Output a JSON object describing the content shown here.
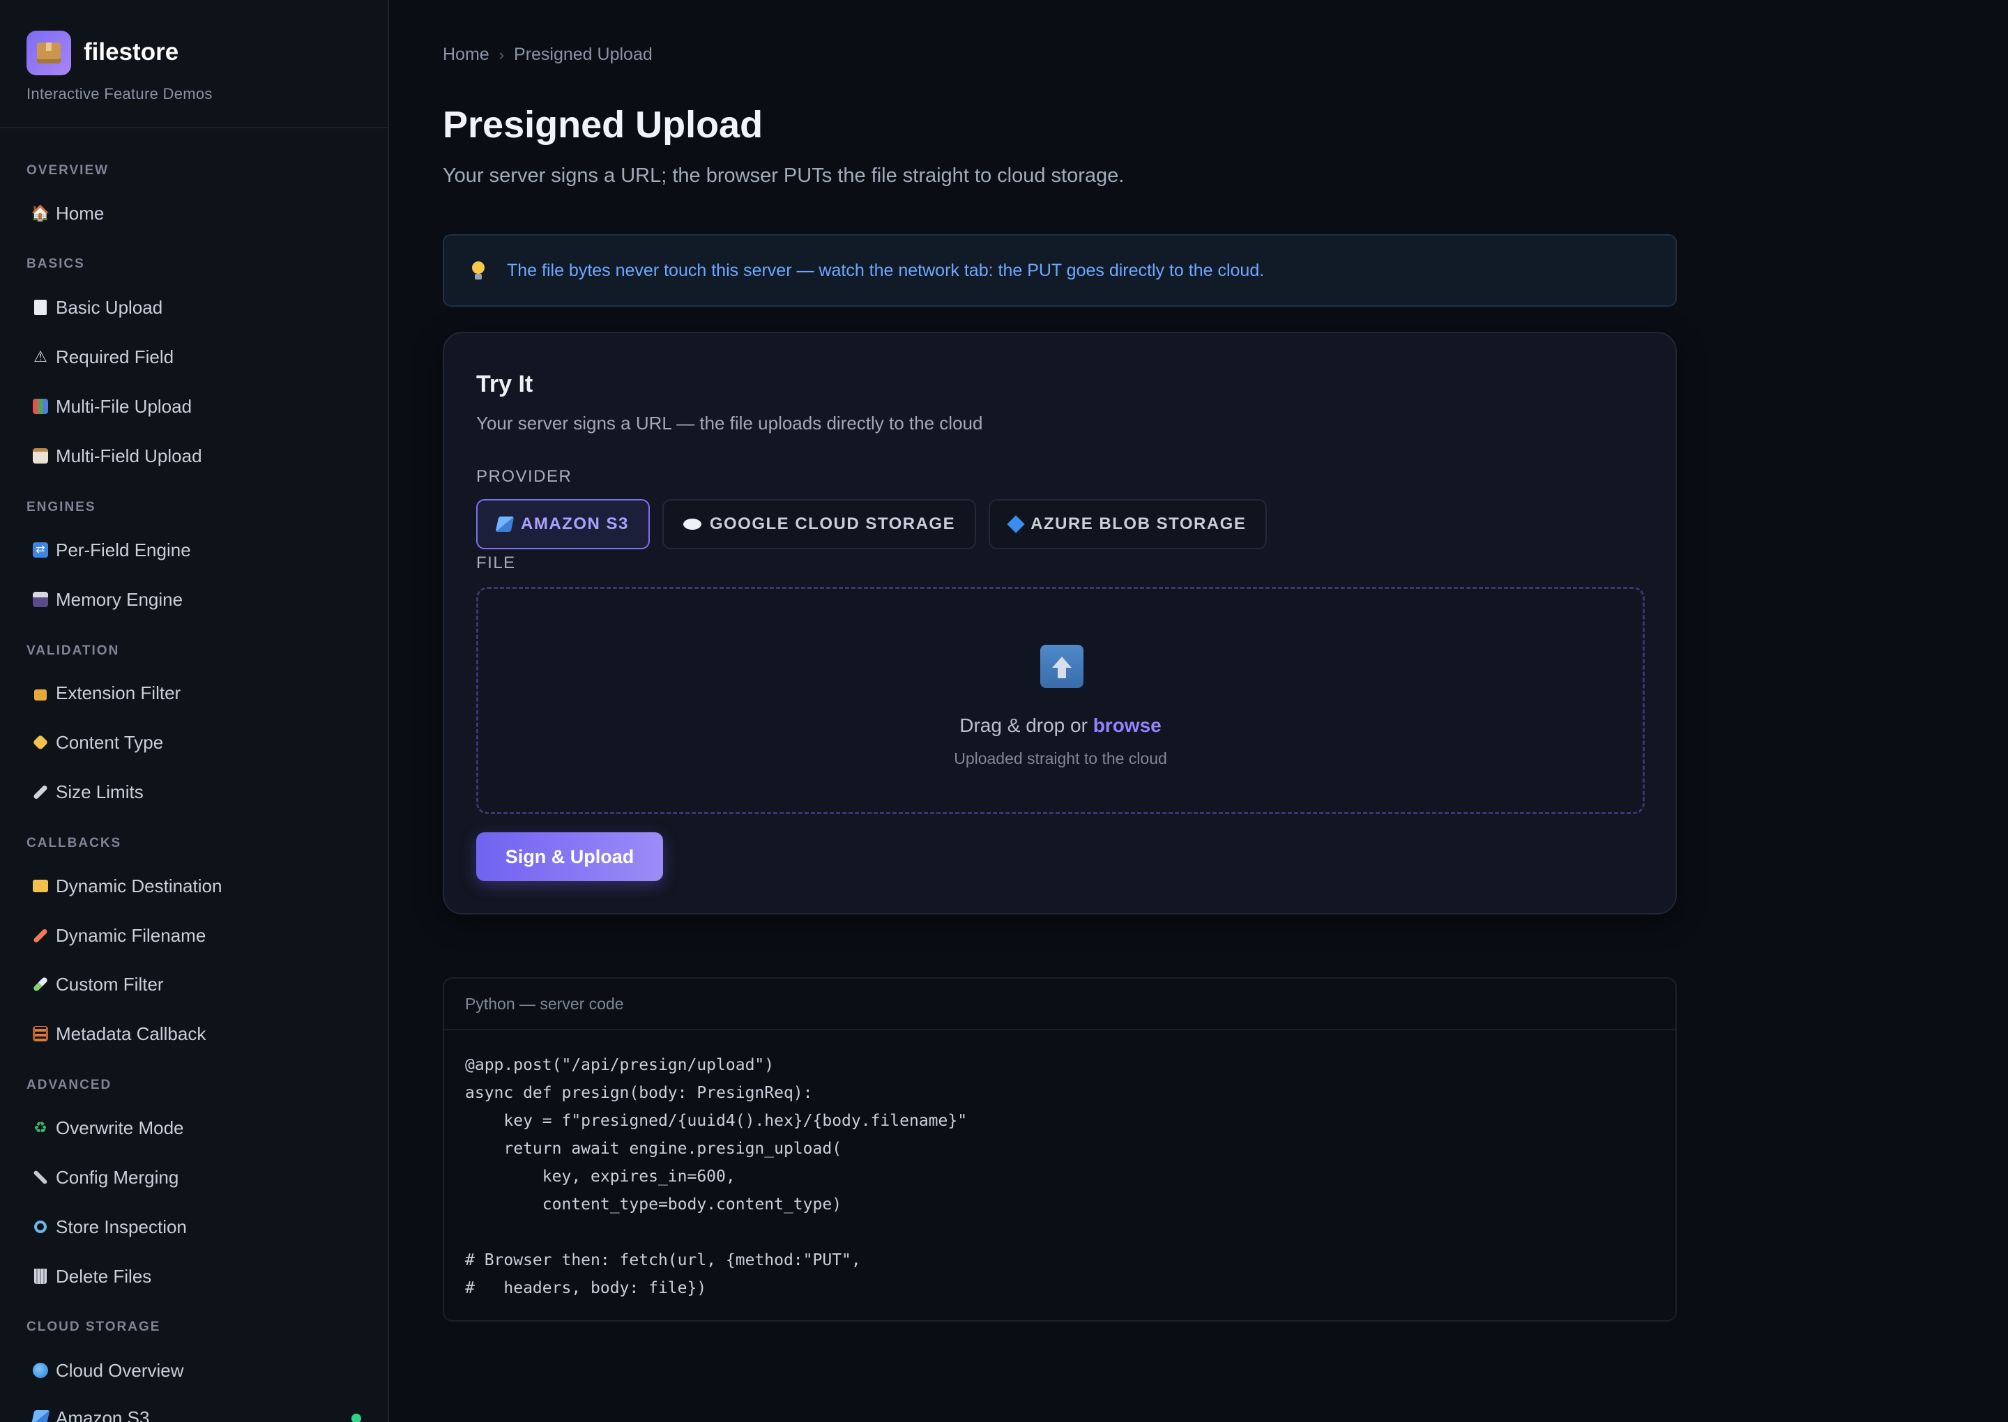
{
  "brand": {
    "name": "filestore",
    "subtitle": "Interactive Feature Demos",
    "logo_icon": "package-icon"
  },
  "sidebar": {
    "sections": [
      {
        "label": "OVERVIEW",
        "items": [
          {
            "label": "Home",
            "icon": "house-icon"
          }
        ]
      },
      {
        "label": "BASICS",
        "items": [
          {
            "label": "Basic Upload",
            "icon": "page-icon"
          },
          {
            "label": "Required Field",
            "icon": "warning-icon"
          },
          {
            "label": "Multi-File Upload",
            "icon": "books-icon"
          },
          {
            "label": "Multi-Field Upload",
            "icon": "clipboard-icon"
          }
        ]
      },
      {
        "label": "ENGINES",
        "items": [
          {
            "label": "Per-Field Engine",
            "icon": "shuffle-icon"
          },
          {
            "label": "Memory Engine",
            "icon": "floppy-disk-icon"
          }
        ]
      },
      {
        "label": "VALIDATION",
        "items": [
          {
            "label": "Extension Filter",
            "icon": "lock-icon"
          },
          {
            "label": "Content Type",
            "icon": "tag-icon"
          },
          {
            "label": "Size Limits",
            "icon": "ruler-icon"
          }
        ]
      },
      {
        "label": "CALLBACKS",
        "items": [
          {
            "label": "Dynamic Destination",
            "icon": "folder-icon"
          },
          {
            "label": "Dynamic Filename",
            "icon": "pencil-icon"
          },
          {
            "label": "Custom Filter",
            "icon": "test-tube-icon"
          },
          {
            "label": "Metadata Callback",
            "icon": "abacus-icon"
          }
        ]
      },
      {
        "label": "ADVANCED",
        "items": [
          {
            "label": "Overwrite Mode",
            "icon": "recycle-icon"
          },
          {
            "label": "Config Merging",
            "icon": "wrench-icon"
          },
          {
            "label": "Store Inspection",
            "icon": "magnifier-icon"
          },
          {
            "label": "Delete Files",
            "icon": "wastebasket-icon"
          }
        ]
      },
      {
        "label": "CLOUD STORAGE",
        "items": [
          {
            "label": "Cloud Overview",
            "icon": "globe-icon"
          },
          {
            "label": "Amazon S3",
            "icon": "s3-icon",
            "status": "online"
          }
        ]
      }
    ]
  },
  "breadcrumb": {
    "home": "Home",
    "current": "Presigned Upload"
  },
  "page": {
    "title": "Presigned Upload",
    "subtitle": "Your server signs a URL; the browser PUTs the file straight to cloud storage."
  },
  "info": {
    "icon": "lightbulb-icon",
    "text": "The file bytes never touch this server — watch the network tab: the PUT goes directly to the cloud."
  },
  "card": {
    "title": "Try It",
    "subtitle": "Your server signs a URL — the file uploads directly to the cloud",
    "provider_label": "PROVIDER",
    "providers": [
      {
        "label": "AMAZON S3",
        "icon": "s3-icon",
        "selected": true
      },
      {
        "label": "GOOGLE CLOUD STORAGE",
        "icon": "cloud-icon",
        "selected": false
      },
      {
        "label": "AZURE BLOB STORAGE",
        "icon": "diamond-icon",
        "selected": false
      }
    ],
    "file_label": "FILE",
    "dropzone": {
      "icon": "upload-arrow-icon",
      "text": "Drag & drop or ",
      "browse": "browse",
      "hint": "Uploaded straight to the cloud"
    },
    "submit_label": "Sign & Upload"
  },
  "code": {
    "header": "Python — server code",
    "lines": [
      "@app.post(\"/api/presign/upload\")",
      "async def presign(body: PresignReq):",
      "    key = f\"presigned/{uuid4().hex}/{body.filename}\"",
      "    return await engine.presign_upload(",
      "        key, expires_in=600,",
      "        content_type=body.content_type)",
      "",
      "# Browser then: fetch(url, {method:\"PUT\",",
      "#   headers, body: file})"
    ]
  },
  "colors": {
    "accent": "#7b72ef",
    "background": "#0a0d14",
    "info_text": "#6ea8ff",
    "status_online": "#2fd38a"
  }
}
